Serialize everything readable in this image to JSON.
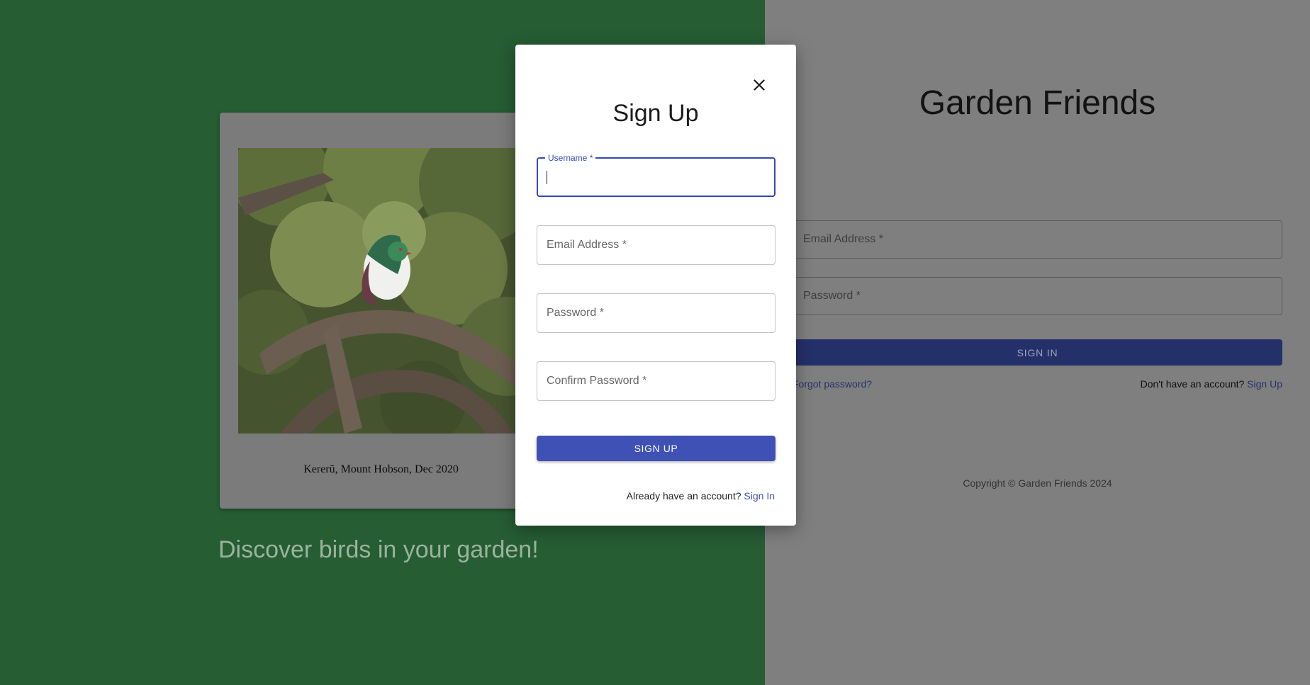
{
  "background": {
    "left_color": "#265d33",
    "right_color": "#7f7f7f",
    "photo_caption": "Kererū, Mount Hobson, Dec 2020",
    "tagline": "Discover birds in your garden!",
    "app_title": "Garden Friends",
    "signin_form": {
      "email_label": "Email Address *",
      "password_label": "Password *",
      "signin_button": "SIGN IN",
      "forgot_link": "Forgot password?",
      "signup_prompt": "Don't have an account?",
      "signup_link": "Sign Up"
    },
    "copyright": "Copyright © Garden Friends 2024"
  },
  "modal": {
    "title": "Sign Up",
    "close_icon": "close-icon",
    "fields": {
      "username_label": "Username *",
      "username_value": "",
      "email_label": "Email Address *",
      "password_label": "Password *",
      "confirm_label": "Confirm Password *"
    },
    "signup_button": "SIGN UP",
    "signin_prompt": "Already have an account?",
    "signin_link": "Sign In",
    "accent_color": "#3f51b5"
  }
}
